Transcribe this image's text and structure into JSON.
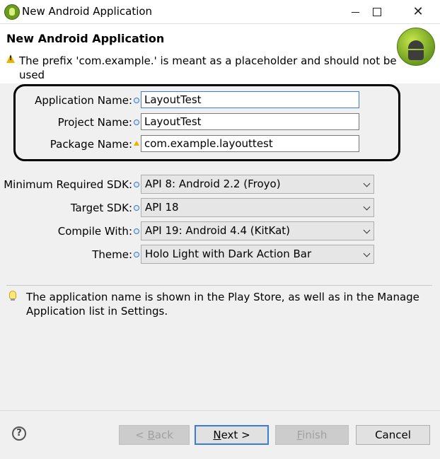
{
  "window": {
    "title": "New Android Application",
    "app_icon": "eclipse-adt-icon"
  },
  "header": {
    "title": "New Android Application",
    "message": "The prefix 'com.example.' is meant as a placeholder and should not be used",
    "message_icon": "warning-icon",
    "logo": "android-logo"
  },
  "fields": {
    "application_name": {
      "label": "Application Name:",
      "value": "LayoutTest",
      "status": "info"
    },
    "project_name": {
      "label": "Project Name:",
      "value": "LayoutTest",
      "status": "info"
    },
    "package_name": {
      "label": "Package Name:",
      "value": "com.example.layouttest",
      "status": "warning"
    }
  },
  "selects": {
    "min_sdk": {
      "label": "Minimum Required SDK:",
      "value": "API 8: Android 2.2 (Froyo)"
    },
    "target_sdk": {
      "label": "Target SDK:",
      "value": "API 18"
    },
    "compile_with": {
      "label": "Compile With:",
      "value": "API 19: Android 4.4 (KitKat)"
    },
    "theme": {
      "label": "Theme:",
      "value": "Holo Light with Dark Action Bar"
    }
  },
  "hint": {
    "icon": "lightbulb-icon",
    "text": "The application name is shown in the Play Store, as well as in the Manage Application list in Settings."
  },
  "buttons": {
    "help": "?",
    "back": {
      "mnemonic": "B",
      "rest": "ack",
      "prefix": "< "
    },
    "next": {
      "mnemonic": "N",
      "rest": "ext >"
    },
    "finish": {
      "mnemonic": "F",
      "rest": "inish"
    },
    "cancel": "Cancel"
  },
  "colors": {
    "focus_border": "#3d7bd8",
    "warning": "#e8b400",
    "android_green": "#a4c639"
  }
}
